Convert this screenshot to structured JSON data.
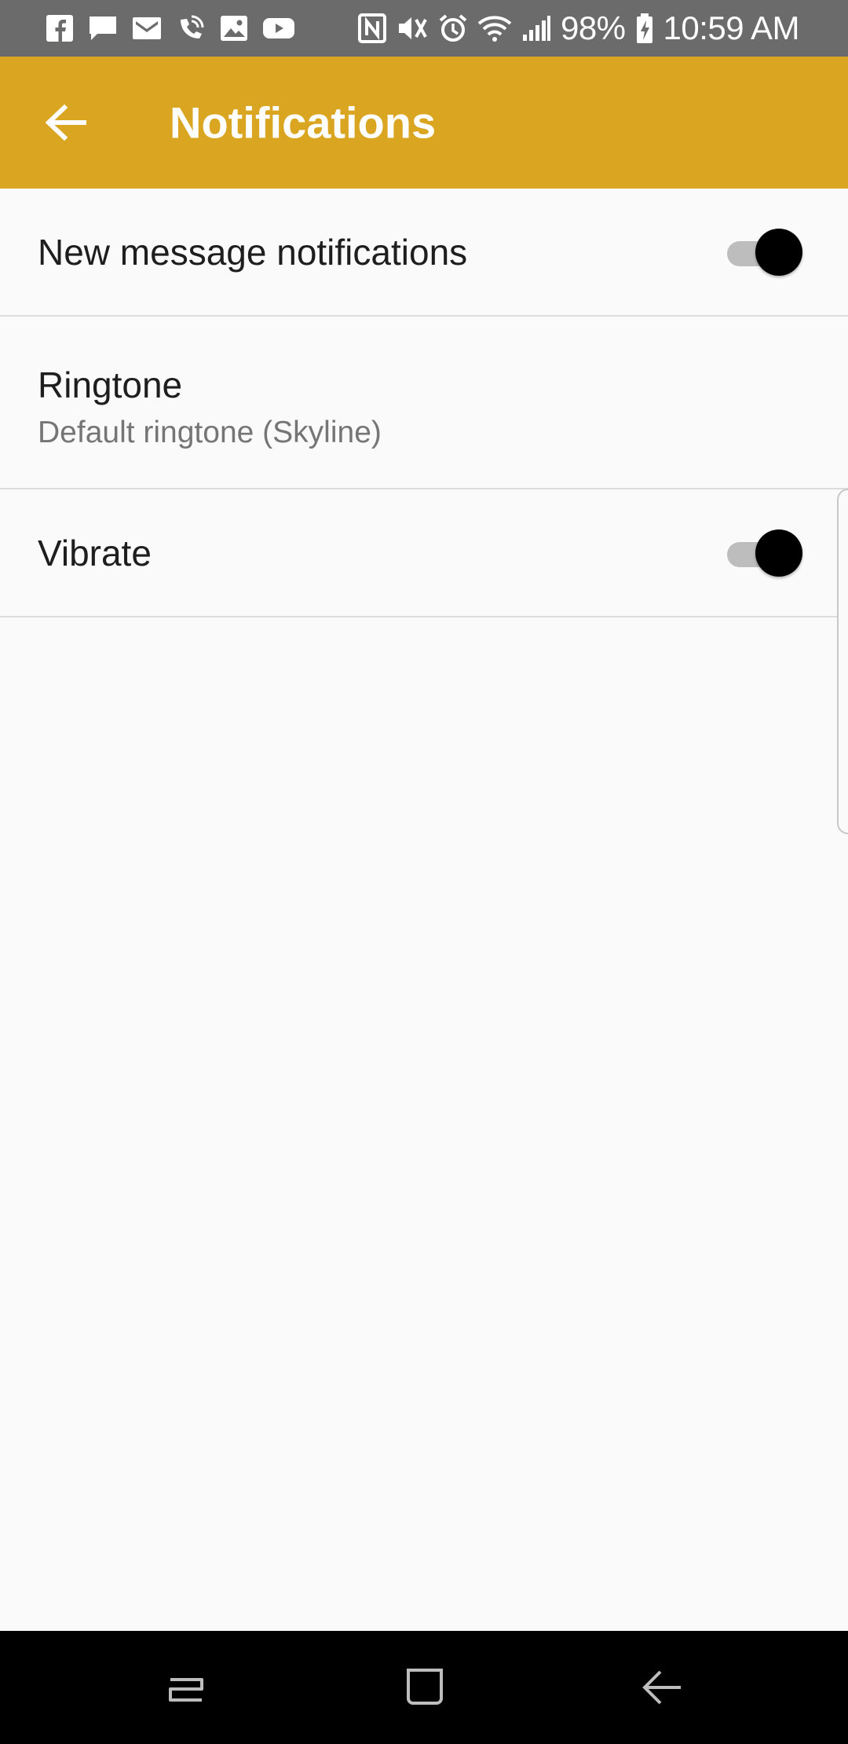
{
  "status_bar": {
    "battery_text": "98%",
    "time": "10:59 AM",
    "left_icons": [
      "facebook-icon",
      "message-icon",
      "gmail-icon",
      "wifi-call-icon",
      "image-icon",
      "youtube-icon"
    ],
    "right_icons": [
      "nfc-icon",
      "vibrate-mute-icon",
      "alarm-icon",
      "wifi-icon",
      "signal-icon",
      "battery-charging-icon"
    ]
  },
  "app_bar": {
    "title": "Notifications",
    "back_icon": "arrow-back-icon",
    "color": "#daa520"
  },
  "settings": [
    {
      "title": "New message notifications",
      "type": "switch",
      "checked": true
    },
    {
      "title": "Ringtone",
      "subtitle": "Default ringtone (Skyline)",
      "type": "preference"
    },
    {
      "title": "Vibrate",
      "type": "switch",
      "checked": true
    }
  ],
  "nav_bar": {
    "buttons": [
      "recent-apps-icon",
      "home-icon",
      "back-icon"
    ]
  }
}
